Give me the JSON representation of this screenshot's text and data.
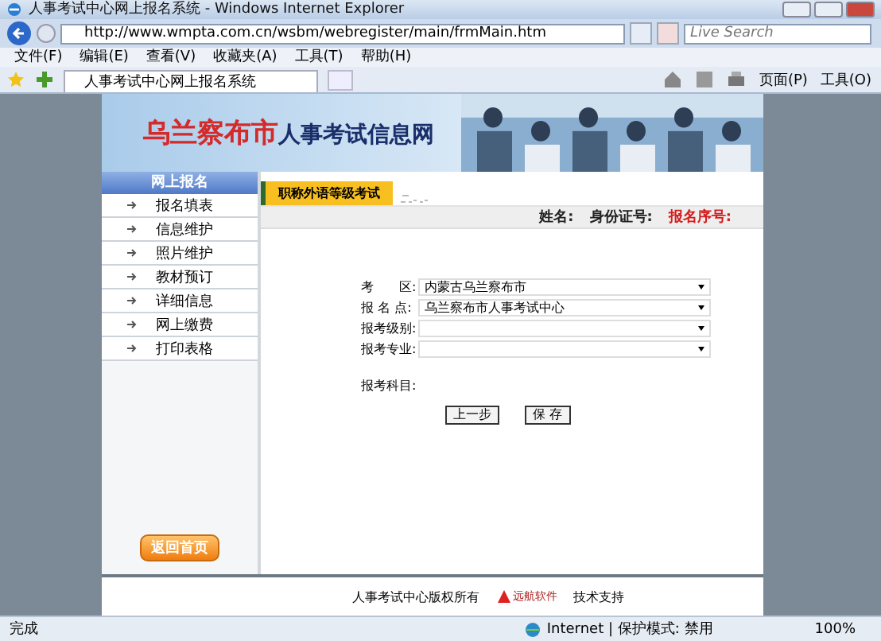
{
  "window": {
    "title": "人事考试中心网上报名系统 - Windows Internet Explorer"
  },
  "address_bar": {
    "url": "http://www.wmpta.com.cn/wsbm/webregister/main/frmMain.htm"
  },
  "search": {
    "placeholder": "Live Search"
  },
  "menu": [
    "文件(F)",
    "编辑(E)",
    "查看(V)",
    "收藏夹(A)",
    "工具(T)",
    "帮助(H)"
  ],
  "tab": {
    "title": "人事考试中心网上报名系统"
  },
  "command_bar": [
    "页面(P)",
    "工具(O)"
  ],
  "site": {
    "title_city": "乌兰察布市",
    "title_rest": "人事考试信息网"
  },
  "sidebar": {
    "heading": "网上报名",
    "items": [
      {
        "label": "报名填表"
      },
      {
        "label": "信息维护"
      },
      {
        "label": "照片维护"
      },
      {
        "label": "教材预订"
      },
      {
        "label": "详细信息"
      },
      {
        "label": "网上缴费"
      },
      {
        "label": "打印表格"
      }
    ],
    "home_button": "返回首页"
  },
  "exam_tab": "职称外语等级考试",
  "info": [
    {
      "label": "姓名:",
      "highlight": false
    },
    {
      "label": "身份证号:",
      "highlight": false
    },
    {
      "label": "报名序号:",
      "highlight": true
    }
  ],
  "form": [
    {
      "label": "考　　区:",
      "kind": "select",
      "value": "内蒙古乌兰察布市"
    },
    {
      "label": "报 名 点:",
      "kind": "select",
      "value": "乌兰察布市人事考试中心"
    },
    {
      "label": "报考级别:",
      "kind": "select"
    },
    {
      "label": "报考专业:",
      "kind": "select"
    },
    {
      "label": "报考科目:",
      "kind": "text"
    }
  ],
  "buttons": [
    "上一步",
    "保 存"
  ],
  "footer": {
    "copyright": "人事考试中心版权所有",
    "logo": "远航软件",
    "support": "技术支持"
  },
  "status_bar": {
    "text": "完成",
    "zone": "Internet | 保护模式: 禁用",
    "zoom": "100%"
  }
}
